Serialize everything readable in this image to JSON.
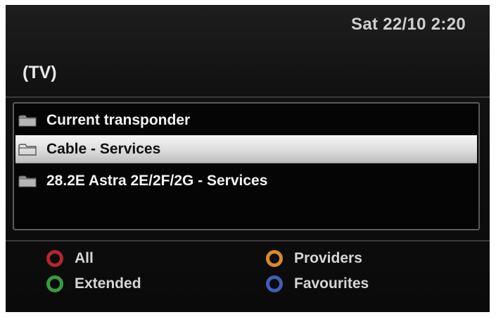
{
  "header": {
    "clock": "Sat 22/10  2:20",
    "title": "(TV)"
  },
  "list": {
    "items": [
      {
        "label": "Current transponder",
        "icon": "folder-icon",
        "selected": false
      },
      {
        "label": "Cable - Services",
        "icon": "folder-open-icon",
        "selected": true
      },
      {
        "label": "28.2E Astra 2E/2F/2G - Services",
        "icon": "folder-icon",
        "selected": false
      }
    ]
  },
  "legend": {
    "red": {
      "label": "All",
      "color": "#b3262b"
    },
    "green": {
      "label": "Extended",
      "color": "#3a9a3e"
    },
    "orange": {
      "label": "Providers",
      "color": "#d98a2b"
    },
    "blue": {
      "label": "Favourites",
      "color": "#3f5fb5"
    }
  }
}
